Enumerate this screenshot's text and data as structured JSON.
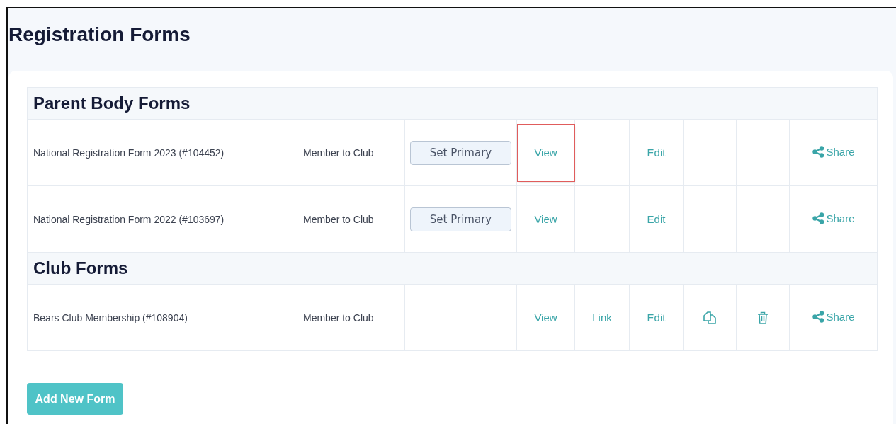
{
  "title": "Registration Forms",
  "sections": [
    {
      "title": "Parent Body Forms",
      "rows": [
        {
          "cells": [
            {
              "kind": "text",
              "text": "National Registration Form 2023 (#104452)"
            },
            {
              "kind": "text",
              "text": "Member to Club"
            },
            {
              "kind": "button",
              "label": "Set Primary"
            },
            {
              "kind": "link",
              "label": "View",
              "highlighted": true
            },
            {
              "kind": "empty"
            },
            {
              "kind": "link",
              "label": "Edit",
              "highlighted": false
            },
            {
              "kind": "empty"
            },
            {
              "kind": "empty"
            },
            {
              "kind": "share",
              "label": "Share"
            }
          ]
        },
        {
          "cells": [
            {
              "kind": "text",
              "text": "National Registration Form 2022 (#103697)"
            },
            {
              "kind": "text",
              "text": "Member to Club"
            },
            {
              "kind": "button",
              "label": "Set Primary"
            },
            {
              "kind": "link",
              "label": "View",
              "highlighted": false
            },
            {
              "kind": "empty"
            },
            {
              "kind": "link",
              "label": "Edit",
              "highlighted": false
            },
            {
              "kind": "empty"
            },
            {
              "kind": "empty"
            },
            {
              "kind": "share",
              "label": "Share"
            }
          ]
        }
      ]
    },
    {
      "title": "Club Forms",
      "rows": [
        {
          "cells": [
            {
              "kind": "text",
              "text": "Bears Club Membership (#108904)"
            },
            {
              "kind": "text",
              "text": "Member to Club"
            },
            {
              "kind": "empty"
            },
            {
              "kind": "link",
              "label": "View",
              "highlighted": false
            },
            {
              "kind": "link",
              "label": "Link",
              "highlighted": false
            },
            {
              "kind": "link",
              "label": "Edit",
              "highlighted": false
            },
            {
              "kind": "copy"
            },
            {
              "kind": "delete"
            },
            {
              "kind": "share",
              "label": "Share"
            }
          ]
        }
      ]
    }
  ],
  "add_button": "Add New Form"
}
